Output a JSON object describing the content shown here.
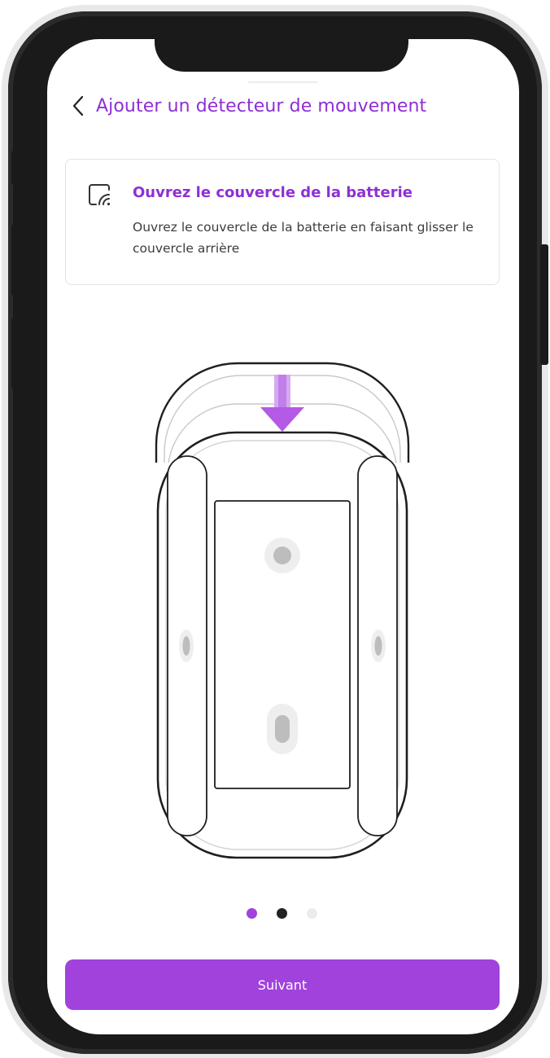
{
  "header": {
    "back_icon": "chevron-left-icon",
    "title": "Ajouter un détecteur de mouvement"
  },
  "card": {
    "icon": "sensor-signal-icon",
    "title": "Ouvrez le couvercle de la batterie",
    "description": "Ouvrez le couvercle de la batterie en faisant glisser le couvercle arrière"
  },
  "pagination": {
    "total": 3,
    "active_index": 0,
    "colors": {
      "active": "#a142dd",
      "next": "#222222",
      "inactive": "#ececec"
    }
  },
  "next_button": {
    "label": "Suivant"
  },
  "theme": {
    "accent": "#8e2fd6",
    "button": "#a142dd",
    "arrow": "#b45ae6"
  }
}
